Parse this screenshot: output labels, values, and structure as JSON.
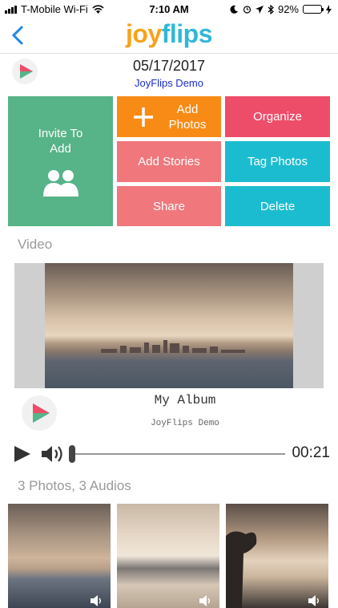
{
  "status_bar": {
    "carrier": "T-Mobile Wi-Fi",
    "time": "7:10 AM",
    "battery_percent": "92%",
    "battery_level": 0.92
  },
  "nav": {
    "logo_part1": "j",
    "logo_part2": "oy",
    "logo_part3": "flips"
  },
  "album": {
    "date": "05/17/2017",
    "name": "JoyFlips Demo"
  },
  "actions": {
    "invite_line1": "Invite To",
    "invite_line2": "Add",
    "add_photos_line1": "Add",
    "add_photos_line2": "Photos",
    "organize": "Organize",
    "add_stories": "Add Stories",
    "tag_photos": "Tag Photos",
    "share": "Share",
    "delete": "Delete"
  },
  "colors": {
    "invite": "#57b388",
    "add_photos": "#f88b16",
    "organize": "#ee4d6a",
    "add_stories": "#f0777c",
    "tag_photos": "#1cbcd0",
    "share": "#f0777c",
    "delete": "#1cbcd0",
    "logo_orange": "#f7a21b",
    "logo_blue": "#31b7d8"
  },
  "video_section": {
    "label": "Video",
    "player_title": "My Album",
    "player_subtitle": "JoyFlips Demo",
    "duration": "00:21",
    "progress": 0.0
  },
  "media_section": {
    "summary": "3 Photos, 3 Audios"
  },
  "icons": {
    "back": "chevron-left-icon",
    "add": "plus-icon",
    "invite": "people-icon",
    "play": "play-icon",
    "volume": "speaker-icon"
  }
}
